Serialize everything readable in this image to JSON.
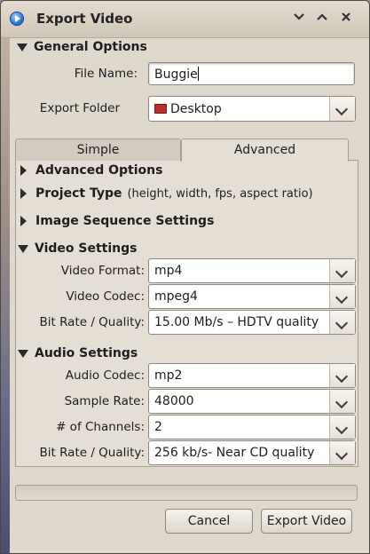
{
  "window": {
    "title": "Export Video",
    "icons": {
      "app": "play-circle-icon",
      "minimize": "chevron-down-icon",
      "maximize": "chevron-up-icon",
      "close": "close-icon"
    }
  },
  "general": {
    "heading": "General Options",
    "file_name_label": "File Name:",
    "file_name_value": "Buggie",
    "export_folder_label": "Export Folder",
    "export_folder_value": "Desktop"
  },
  "tabs": [
    {
      "label": "Simple",
      "active": false
    },
    {
      "label": "Advanced",
      "active": true
    }
  ],
  "advanced": {
    "advanced_options": "Advanced Options",
    "project_type": "Project Type",
    "project_type_hint": "(height, width, fps, aspect ratio)",
    "image_sequence": "Image Sequence Settings"
  },
  "video": {
    "heading": "Video Settings",
    "format_label": "Video Format:",
    "format_value": "mp4",
    "codec_label": "Video Codec:",
    "codec_value": "mpeg4",
    "bitrate_label": "Bit Rate / Quality:",
    "bitrate_value": "15.00 Mb/s – HDTV quality"
  },
  "audio": {
    "heading": "Audio Settings",
    "codec_label": "Audio Codec:",
    "codec_value": "mp2",
    "sample_rate_label": "Sample Rate:",
    "sample_rate_value": "48000",
    "channels_label": "# of Channels:",
    "channels_value": "2",
    "bitrate_label": "Bit Rate / Quality:",
    "bitrate_value": "256 kb/s- Near CD quality"
  },
  "progress": {
    "value": 0
  },
  "buttons": {
    "cancel": "Cancel",
    "export": "Export Video"
  }
}
